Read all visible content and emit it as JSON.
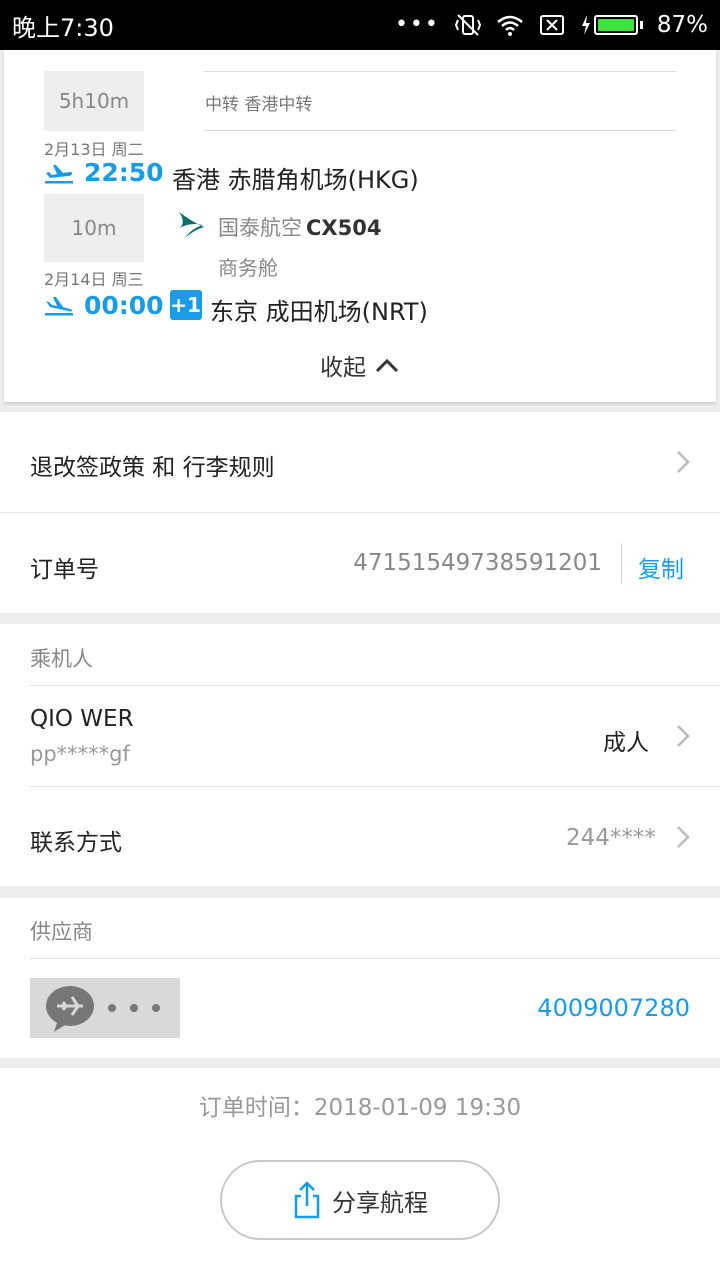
{
  "status_bar": {
    "time": "晚上7:30",
    "dots": "•••",
    "battery": "87%",
    "icons": [
      "vibrate-off-icon",
      "wifi-icon",
      "no-sim-icon",
      "charging-icon",
      "battery-icon"
    ],
    "battery_color": "#3de23d"
  },
  "itinerary": {
    "layover_duration": "5h10m",
    "transfer_text": "中转  香港中转",
    "depart_date": "2月13日 周二",
    "depart_time": "22:50",
    "depart_airport": "香港 赤腊角机场(HKG)",
    "flight_duration": "10m",
    "airline_name": "国泰航空",
    "flight_no": "CX504",
    "cabin": "商务舱",
    "arrive_date": "2月14日 周三",
    "arrive_time": "00:00",
    "day_offset": "+1",
    "arrive_airport": "东京 成田机场(NRT)",
    "collapse_label": "收起"
  },
  "policy": {
    "label": "退改签政策 和 行李规则"
  },
  "order": {
    "label": "订单号",
    "number": "47151549738591201",
    "copy_label": "复制"
  },
  "passengers": {
    "title": "乘机人",
    "name": "QIO WER",
    "id_masked": "pp*****gf",
    "type": "成人",
    "contact_label": "联系方式",
    "contact_value": "244****"
  },
  "supplier": {
    "title": "供应商",
    "phone": "4009007280"
  },
  "order_time": "订单时间：2018-01-09 19:30",
  "share_label": "分享航程",
  "colors": {
    "accent": "#1a9be8",
    "airline_logo": "#0a6e6e"
  }
}
